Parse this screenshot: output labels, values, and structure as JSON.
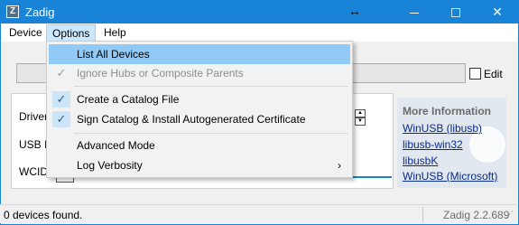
{
  "window": {
    "title": "Zadig",
    "icon_name": "zadig-app-icon",
    "accent_color": "#1883d7"
  },
  "menubar": {
    "items": [
      {
        "label": "Device"
      },
      {
        "label": "Options"
      },
      {
        "label": "Help"
      }
    ]
  },
  "main": {
    "edit_label": "Edit",
    "labels": {
      "driver": "Driver",
      "usb_id": "USB ID",
      "wcid": "WCID"
    },
    "info": {
      "title": "More Information",
      "links": [
        {
          "label": "WinUSB (libusb)"
        },
        {
          "label": "libusb-win32"
        },
        {
          "label": "libusbK"
        },
        {
          "label": "WinUSB (Microsoft)"
        }
      ]
    }
  },
  "dropdown": {
    "items": [
      {
        "label": "List All Devices",
        "checked": false,
        "enabled": true,
        "highlighted": true
      },
      {
        "label": "Ignore Hubs or Composite Parents",
        "checked": true,
        "enabled": false
      },
      {
        "label": "Create a Catalog File",
        "checked": true,
        "enabled": true
      },
      {
        "label": "Sign Catalog & Install Autogenerated Certificate",
        "checked": true,
        "enabled": true
      },
      {
        "label": "Advanced Mode",
        "checked": false,
        "enabled": true
      },
      {
        "label": "Log Verbosity",
        "checked": false,
        "enabled": true,
        "submenu": true
      }
    ]
  },
  "statusbar": {
    "status": "0 devices found.",
    "version": "Zadig 2.2.689"
  }
}
